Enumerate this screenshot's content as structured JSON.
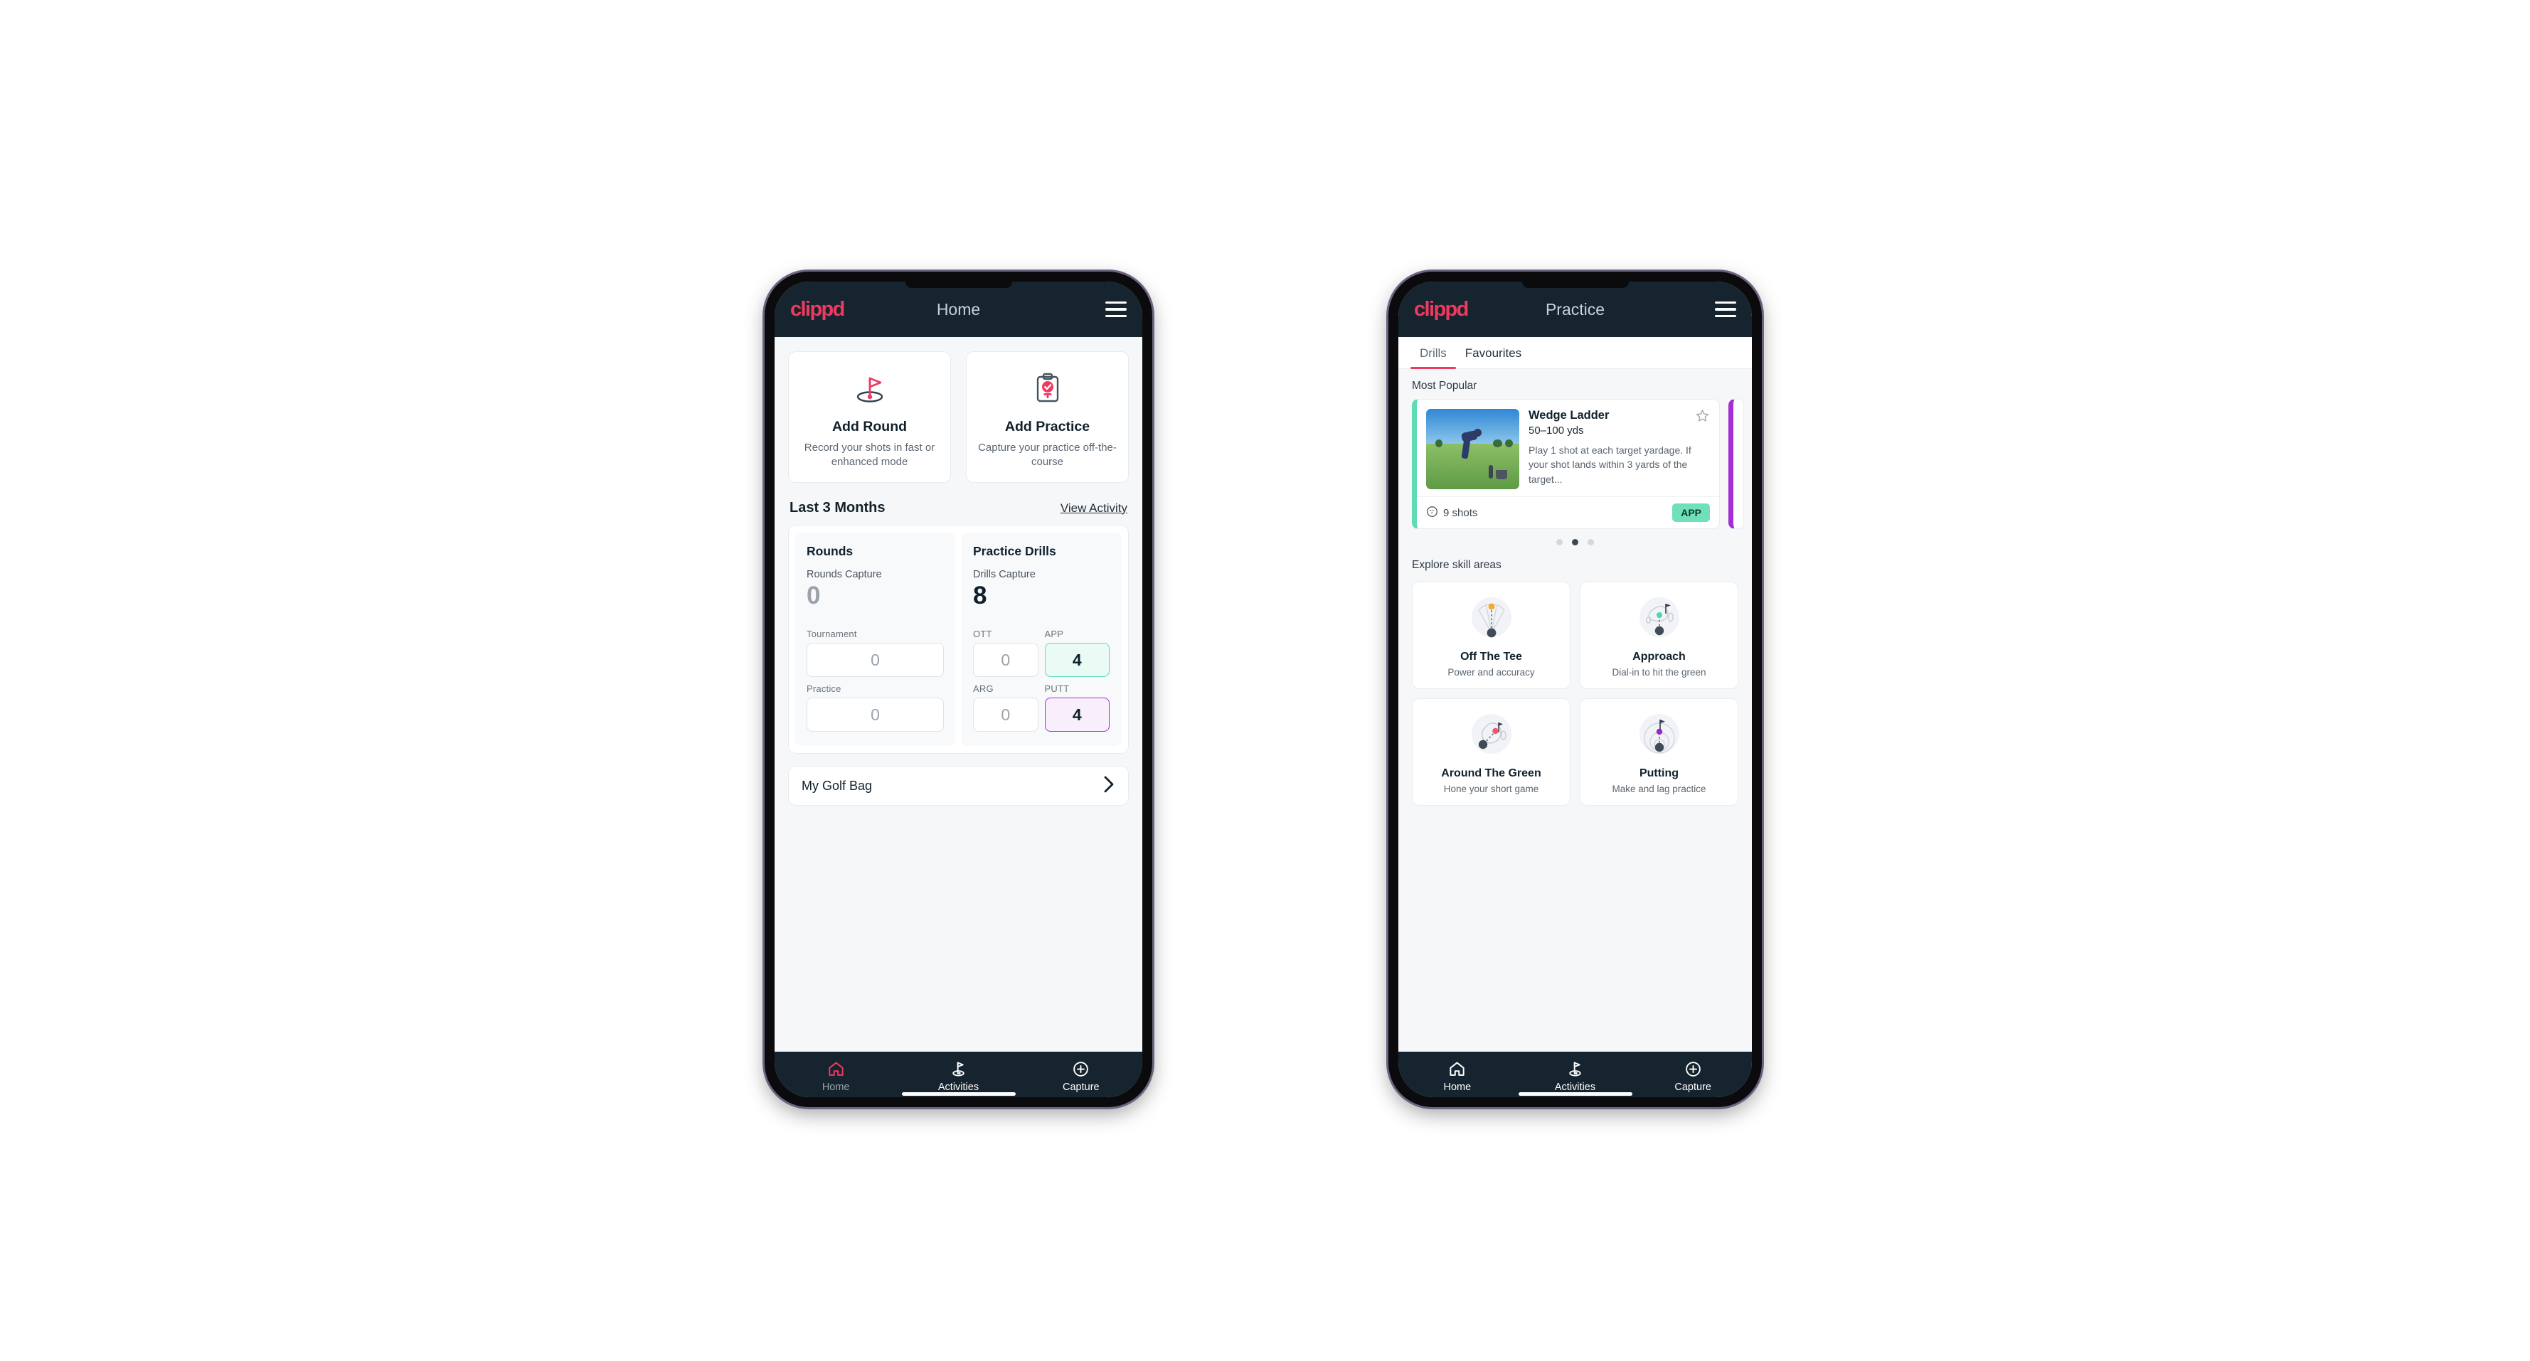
{
  "brand": {
    "logo_text": "clippd",
    "accent": "#ee3a60",
    "appbar_bg": "#15242e"
  },
  "home_screen": {
    "appbar": {
      "title": "Home",
      "menu_icon": "hamburger-menu-icon"
    },
    "actions": [
      {
        "icon": "golf-flag-hole-icon",
        "title": "Add Round",
        "subtitle": "Record your shots in fast or enhanced mode"
      },
      {
        "icon": "clipboard-check-icon",
        "title": "Add Practice",
        "subtitle": "Capture your practice off-the-course"
      }
    ],
    "section": {
      "title": "Last 3 Months",
      "link": "View Activity"
    },
    "rounds": {
      "title": "Rounds",
      "capture_label": "Rounds Capture",
      "capture_value": "0",
      "items": [
        {
          "label": "Tournament",
          "value": "0",
          "state": "empty"
        },
        {
          "label": "Practice",
          "value": "0",
          "state": "empty"
        }
      ]
    },
    "drills": {
      "title": "Practice Drills",
      "capture_label": "Drills Capture",
      "capture_value": "8",
      "items": [
        {
          "label": "OTT",
          "value": "0",
          "state": "empty"
        },
        {
          "label": "APP",
          "value": "4",
          "state": "app",
          "color": "#5fdcb4"
        },
        {
          "label": "ARG",
          "value": "0",
          "state": "empty"
        },
        {
          "label": "PUTT",
          "value": "4",
          "state": "putt",
          "color": "#a32fd0"
        }
      ]
    },
    "golf_bag": {
      "label": "My Golf Bag",
      "chevron": "chevron-right-icon"
    },
    "bottom_nav": [
      {
        "icon": "home-icon",
        "label": "Home",
        "active": true
      },
      {
        "icon": "golf-flag-icon",
        "label": "Activities",
        "active": false
      },
      {
        "icon": "plus-circle-icon",
        "label": "Capture",
        "active": false
      }
    ]
  },
  "practice_screen": {
    "appbar": {
      "title": "Practice",
      "menu_icon": "hamburger-menu-icon"
    },
    "tabs": [
      {
        "label": "Drills",
        "active": true
      },
      {
        "label": "Favourites",
        "active": false
      }
    ],
    "most_popular_label": "Most Popular",
    "drill": {
      "name": "Wedge Ladder",
      "yardage": "50–100 yds",
      "description": "Play 1 shot at each target yardage. If your shot lands within 3 yards of the target...",
      "shots": "9 shots",
      "shots_icon": "golf-ball-icon",
      "badge": "APP",
      "badge_color": "#6fe0b9",
      "accent_color": "#5fdcb4",
      "next_accent_color": "#a32fd0",
      "favourite_icon": "star-outline-icon",
      "thumbnail": "golfer-hitting-wedge-photo"
    },
    "carousel_dots": {
      "count": 3,
      "active_index": 1
    },
    "skills_label": "Explore skill areas",
    "skills": [
      {
        "icon": "tee-shot-fan-icon",
        "name": "Off The Tee",
        "subtitle": "Power and accuracy",
        "dot_color": "#f2a92c"
      },
      {
        "icon": "approach-green-icon",
        "name": "Approach",
        "subtitle": "Dial-in to hit the green",
        "dot_color": "#4fd6ac"
      },
      {
        "icon": "around-green-icon",
        "name": "Around The Green",
        "subtitle": "Hone your short game",
        "dot_color": "#f0566f"
      },
      {
        "icon": "putting-rings-icon",
        "name": "Putting",
        "subtitle": "Make and lag practice",
        "dot_color": "#9a27c9"
      }
    ],
    "bottom_nav": [
      {
        "icon": "home-icon",
        "label": "Home",
        "active": false
      },
      {
        "icon": "golf-flag-icon",
        "label": "Activities",
        "active": true
      },
      {
        "icon": "plus-circle-icon",
        "label": "Capture",
        "active": false
      }
    ]
  }
}
